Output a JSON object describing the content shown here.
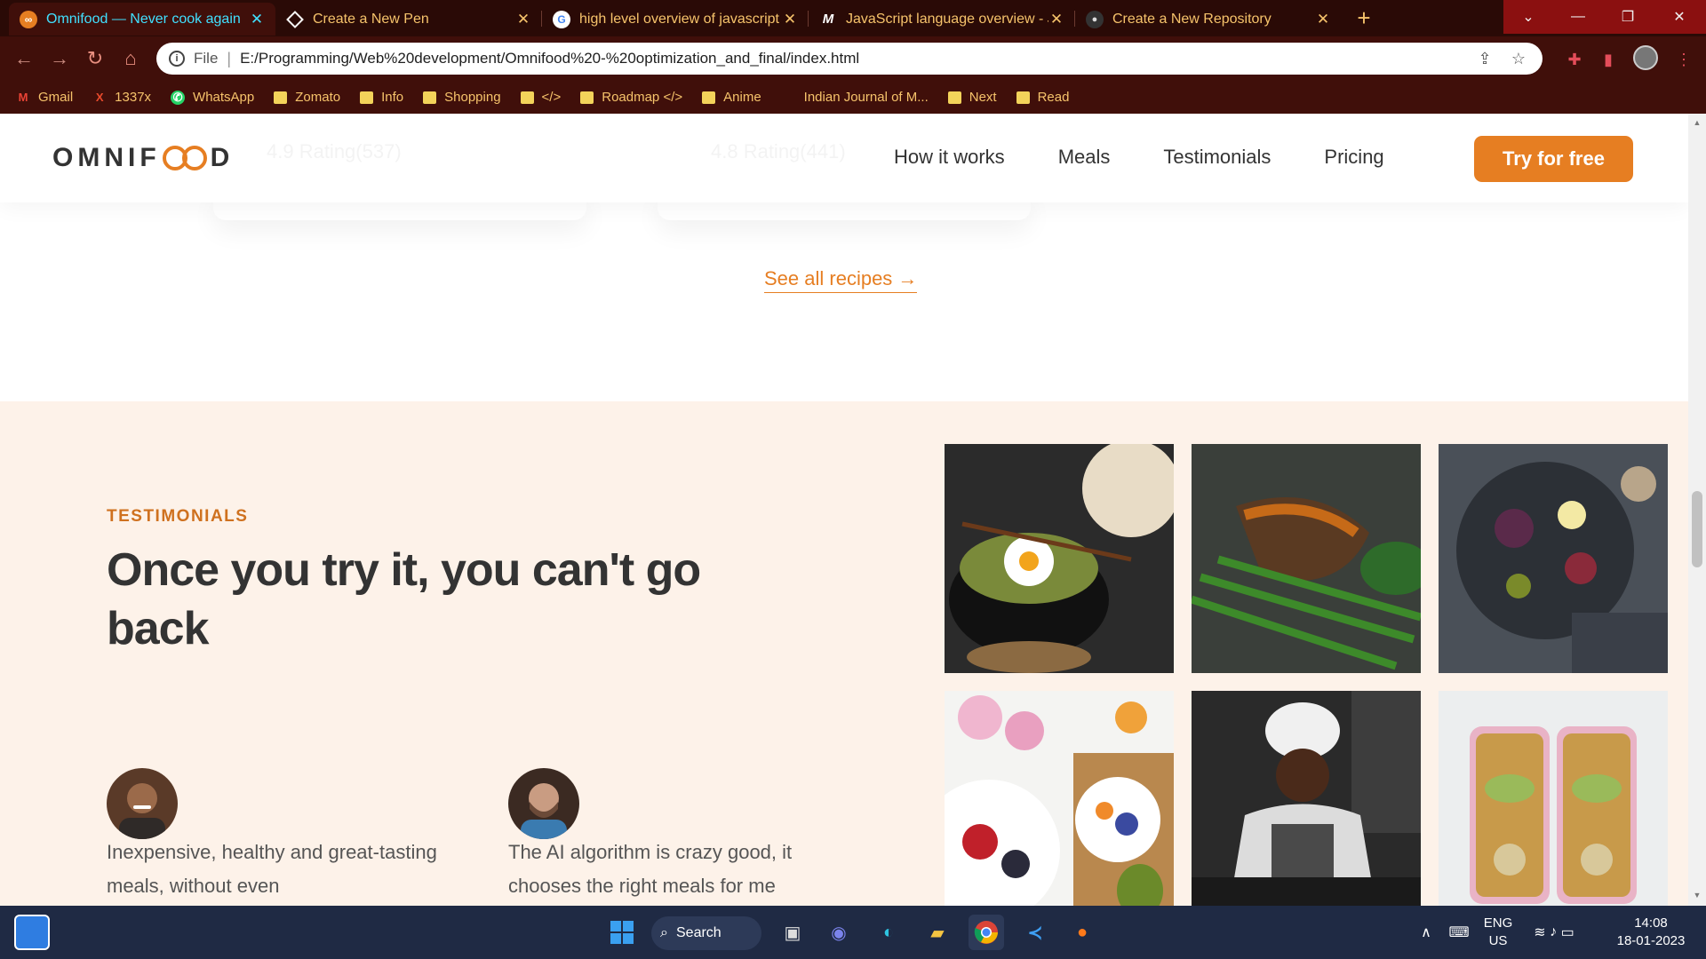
{
  "browser": {
    "tabs": [
      {
        "title": "Omnifood — Never cook again",
        "favicon": "omnifood-icon",
        "active": true
      },
      {
        "title": "Create a New Pen",
        "favicon": "codepen-icon",
        "active": false
      },
      {
        "title": "high level overview of javascript",
        "favicon": "google-icon",
        "active": false
      },
      {
        "title": "JavaScript language overview - Ja",
        "favicon": "mdn-icon",
        "active": false
      },
      {
        "title": "Create a New Repository",
        "favicon": "github-icon",
        "active": false
      }
    ],
    "new_tab": "+",
    "scheme": "File",
    "url": "E:/Programming/Web%20development/Omnifood%20-%20optimization_and_final/index.html",
    "bookmarks": [
      {
        "label": "Gmail",
        "icon": "gmail-icon"
      },
      {
        "label": "1337x",
        "icon": "1337x-icon"
      },
      {
        "label": "WhatsApp",
        "icon": "whatsapp-icon"
      },
      {
        "label": "Zomato",
        "icon": "folder-icon"
      },
      {
        "label": "Info",
        "icon": "folder-icon"
      },
      {
        "label": "Shopping",
        "icon": "folder-icon"
      },
      {
        "label": "</>",
        "icon": "folder-icon"
      },
      {
        "label": "Roadmap </>",
        "icon": "folder-icon"
      },
      {
        "label": "Anime",
        "icon": "folder-icon"
      },
      {
        "label": "Indian Journal of M...",
        "icon": "none"
      },
      {
        "label": "Next",
        "icon": "folder-icon"
      },
      {
        "label": "Read",
        "icon": "folder-icon"
      }
    ],
    "colors": {
      "tab_bar": "#2a0a06",
      "toolbar": "#400f0a",
      "tab_text": "#f6c36b",
      "active_tab_text": "#40e0ff"
    }
  },
  "site": {
    "logo": "OMNIF",
    "logo_end": "D",
    "nav": [
      "How it works",
      "Meals",
      "Testimonials",
      "Pricing"
    ],
    "cta": "Try for free",
    "ghost_ratings": [
      "4.9 Rating(537)",
      "4.8 Rating(441)"
    ],
    "see_all": "See all recipes →",
    "testimonials": {
      "subheading": "TESTIMONIALS",
      "heading": "Once you try it, you can't go back",
      "quotes": [
        "Inexpensive, healthy and great-tasting meals, without even",
        "The AI algorithm is crazy good, it chooses the right meals for me"
      ]
    },
    "gallery_alt": [
      "bibimbap-bowl",
      "steak-green-beans",
      "fig-platter",
      "fruit-breakfast",
      "chef-cooking",
      "meal-prep-boxes"
    ],
    "colors": {
      "accent": "#e67e22",
      "testimonial_bg": "#fdf2e9",
      "heading": "#333333"
    }
  },
  "taskbar": {
    "search": "Search",
    "lang": "ENG",
    "region": "US",
    "time": "14:08",
    "date": "18-01-2023"
  }
}
